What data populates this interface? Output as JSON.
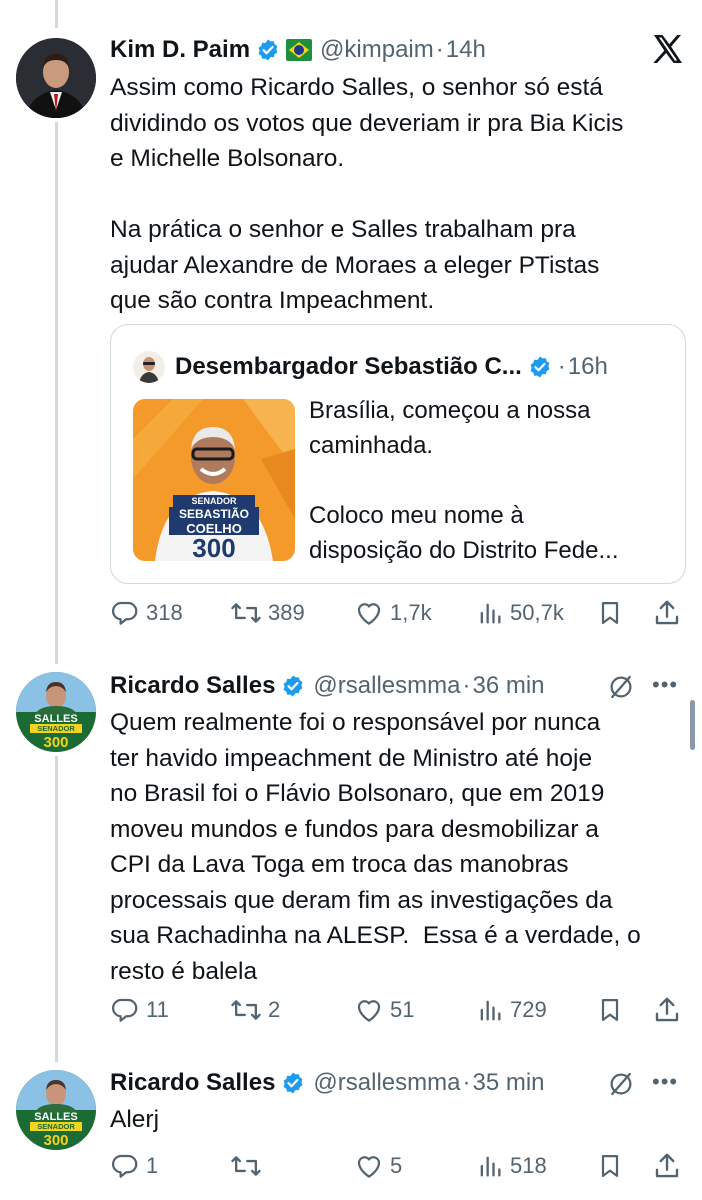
{
  "tweets": [
    {
      "name": "Kim D. Paim",
      "handle": "@kimpaim",
      "time": "14h",
      "text": "Assim como Ricardo Salles, o senhor só está\ndividindo os votos que deveriam ir pra Bia Kicis\ne Michelle Bolsonaro.\n\nNa prática o senhor e Salles trabalham pra\najudar Alexandre de Moraes a eleger PTistas\nque são contra Impeachment.",
      "quote": {
        "name": "Desembargador Sebastião C...",
        "time": "16h",
        "text": "Brasília, começou a nossa\ncaminhada.\n\nColoco meu nome à\ndisposição do Distrito Fede...",
        "image_text": {
          "line1": "SENADOR",
          "line2": "SEBASTIÃO",
          "line3": "COELHO",
          "number": "300"
        }
      },
      "stats": {
        "replies": "318",
        "retweets": "389",
        "likes": "1,7k",
        "views": "50,7k"
      }
    },
    {
      "name": "Ricardo Salles",
      "handle": "@rsallesmma",
      "time": "36 min",
      "text": "Quem realmente foi o responsável por nunca\nter havido impeachment de Ministro até hoje\nno Brasil foi o Flávio Bolsonaro, que em 2019\nmoveu mundos e fundos para desmobilizar a\nCPI da Lava Toga em troca das manobras\nprocessais que deram fim as investigações da\nsua Rachadinha na ALESP.  Essa é a verdade, o\nresto é balela",
      "avatar_text": {
        "line1": "SALLES",
        "line2": "SENADOR",
        "number": "300"
      },
      "stats": {
        "replies": "11",
        "retweets": "2",
        "likes": "51",
        "views": "729"
      }
    },
    {
      "name": "Ricardo Salles",
      "handle": "@rsallesmma",
      "time": "35 min",
      "text": "Alerj",
      "avatar_text": {
        "line1": "SALLES",
        "line2": "SENADOR",
        "number": "300"
      },
      "stats": {
        "replies": "1",
        "retweets": "",
        "likes": "5",
        "views": "518"
      }
    }
  ],
  "colors": {
    "verified": "#1d9bf0",
    "secondary": "#536471",
    "orange": "#f39a2b",
    "green": "#1b6b34"
  },
  "icons": [
    "verified-badge-icon",
    "flag-badge-icon",
    "x-logo-icon",
    "reply-icon",
    "retweet-icon",
    "like-icon",
    "views-icon",
    "bookmark-icon",
    "share-icon",
    "grok-icon",
    "more-icon"
  ]
}
